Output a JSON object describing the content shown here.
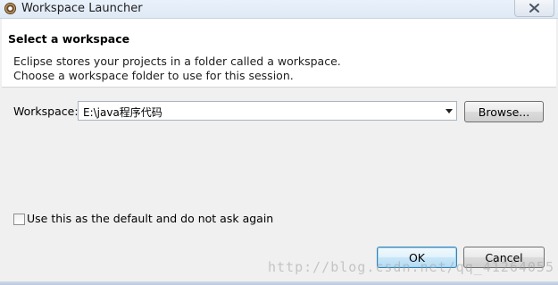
{
  "window": {
    "title": "Workspace Launcher",
    "icon": "eclipse-icon",
    "close_icon": "close-icon"
  },
  "header": {
    "title": "Select a workspace",
    "description_lines": [
      "Eclipse stores your projects in a folder called a workspace.",
      "Choose a workspace folder to use for this session."
    ]
  },
  "workspace": {
    "label": "Workspace:",
    "value": "E:\\java程序代码",
    "browse_label": "Browse..."
  },
  "default_checkbox": {
    "label": "Use this as the default and do not ask again",
    "checked": false
  },
  "buttons": {
    "ok_label": "OK",
    "cancel_label": "Cancel"
  },
  "watermark": {
    "text": "http://blog.csdn.net/qq_41264055"
  }
}
